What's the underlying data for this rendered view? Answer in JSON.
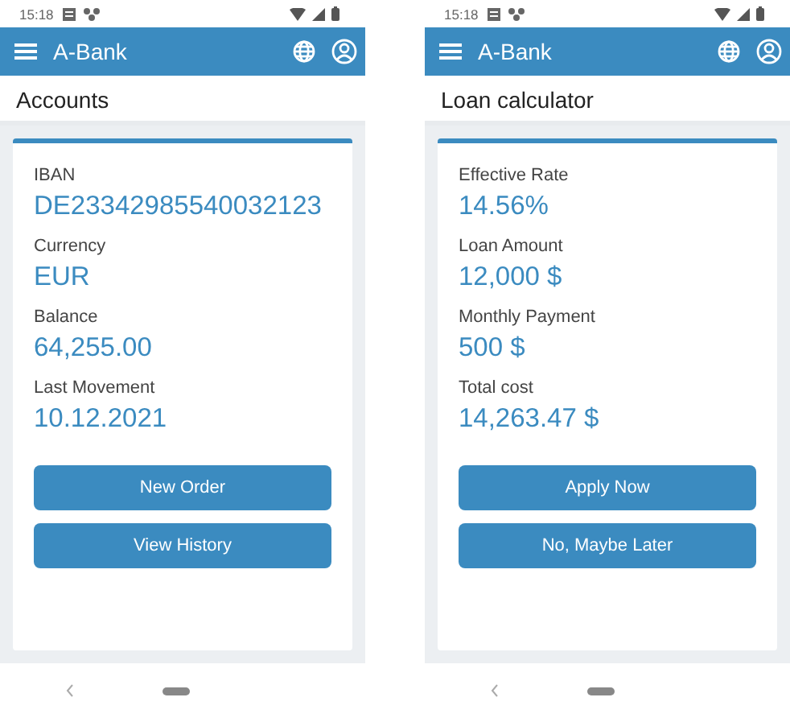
{
  "phones": [
    {
      "status_time": "15:18",
      "app_title": "A-Bank",
      "page_title": "Accounts",
      "fields": [
        {
          "label": "IBAN",
          "value": "DE23342985540032123"
        },
        {
          "label": "Currency",
          "value": "EUR"
        },
        {
          "label": "Balance",
          "value": "64,255.00"
        },
        {
          "label": "Last Movement",
          "value": "10.12.2021"
        }
      ],
      "buttons": [
        "New Order",
        "View History"
      ]
    },
    {
      "status_time": "15:18",
      "app_title": "A-Bank",
      "page_title": "Loan calculator",
      "fields": [
        {
          "label": "Effective Rate",
          "value": "14.56%"
        },
        {
          "label": "Loan Amount",
          "value": "12,000 $"
        },
        {
          "label": "Monthly Payment",
          "value": "500 $"
        },
        {
          "label": "Total cost",
          "value": "14,263.47 $"
        }
      ],
      "buttons": [
        "Apply Now",
        "No, Maybe Later"
      ]
    }
  ]
}
